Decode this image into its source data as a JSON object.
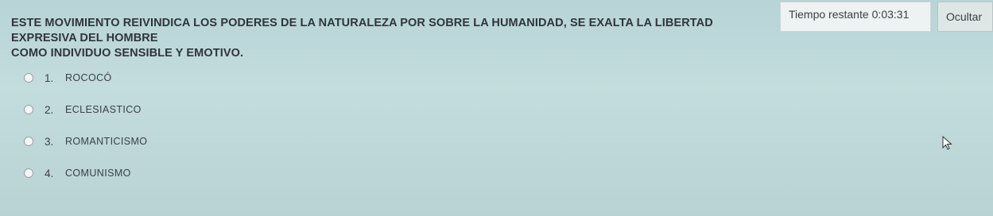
{
  "timer": {
    "label": "Tiempo restante",
    "value": "0:03:31"
  },
  "hide_button": {
    "label": "Ocultar"
  },
  "question": {
    "line1": "ESTE MOVIMIENTO REIVINDICA LOS PODERES DE LA NATURALEZA POR SOBRE LA HUMANIDAD, SE EXALTA LA LIBERTAD EXPRESIVA DEL HOMBRE",
    "line2": "COMO INDIVIDUO SENSIBLE Y EMOTIVO."
  },
  "options": [
    {
      "number": "1.",
      "text": "ROCOCÓ"
    },
    {
      "number": "2.",
      "text": "ECLESIASTICO"
    },
    {
      "number": "3.",
      "text": "ROMANTICISMO"
    },
    {
      "number": "4.",
      "text": "COMUNISMO"
    }
  ],
  "cursor_icon": "mouse-pointer-icon"
}
